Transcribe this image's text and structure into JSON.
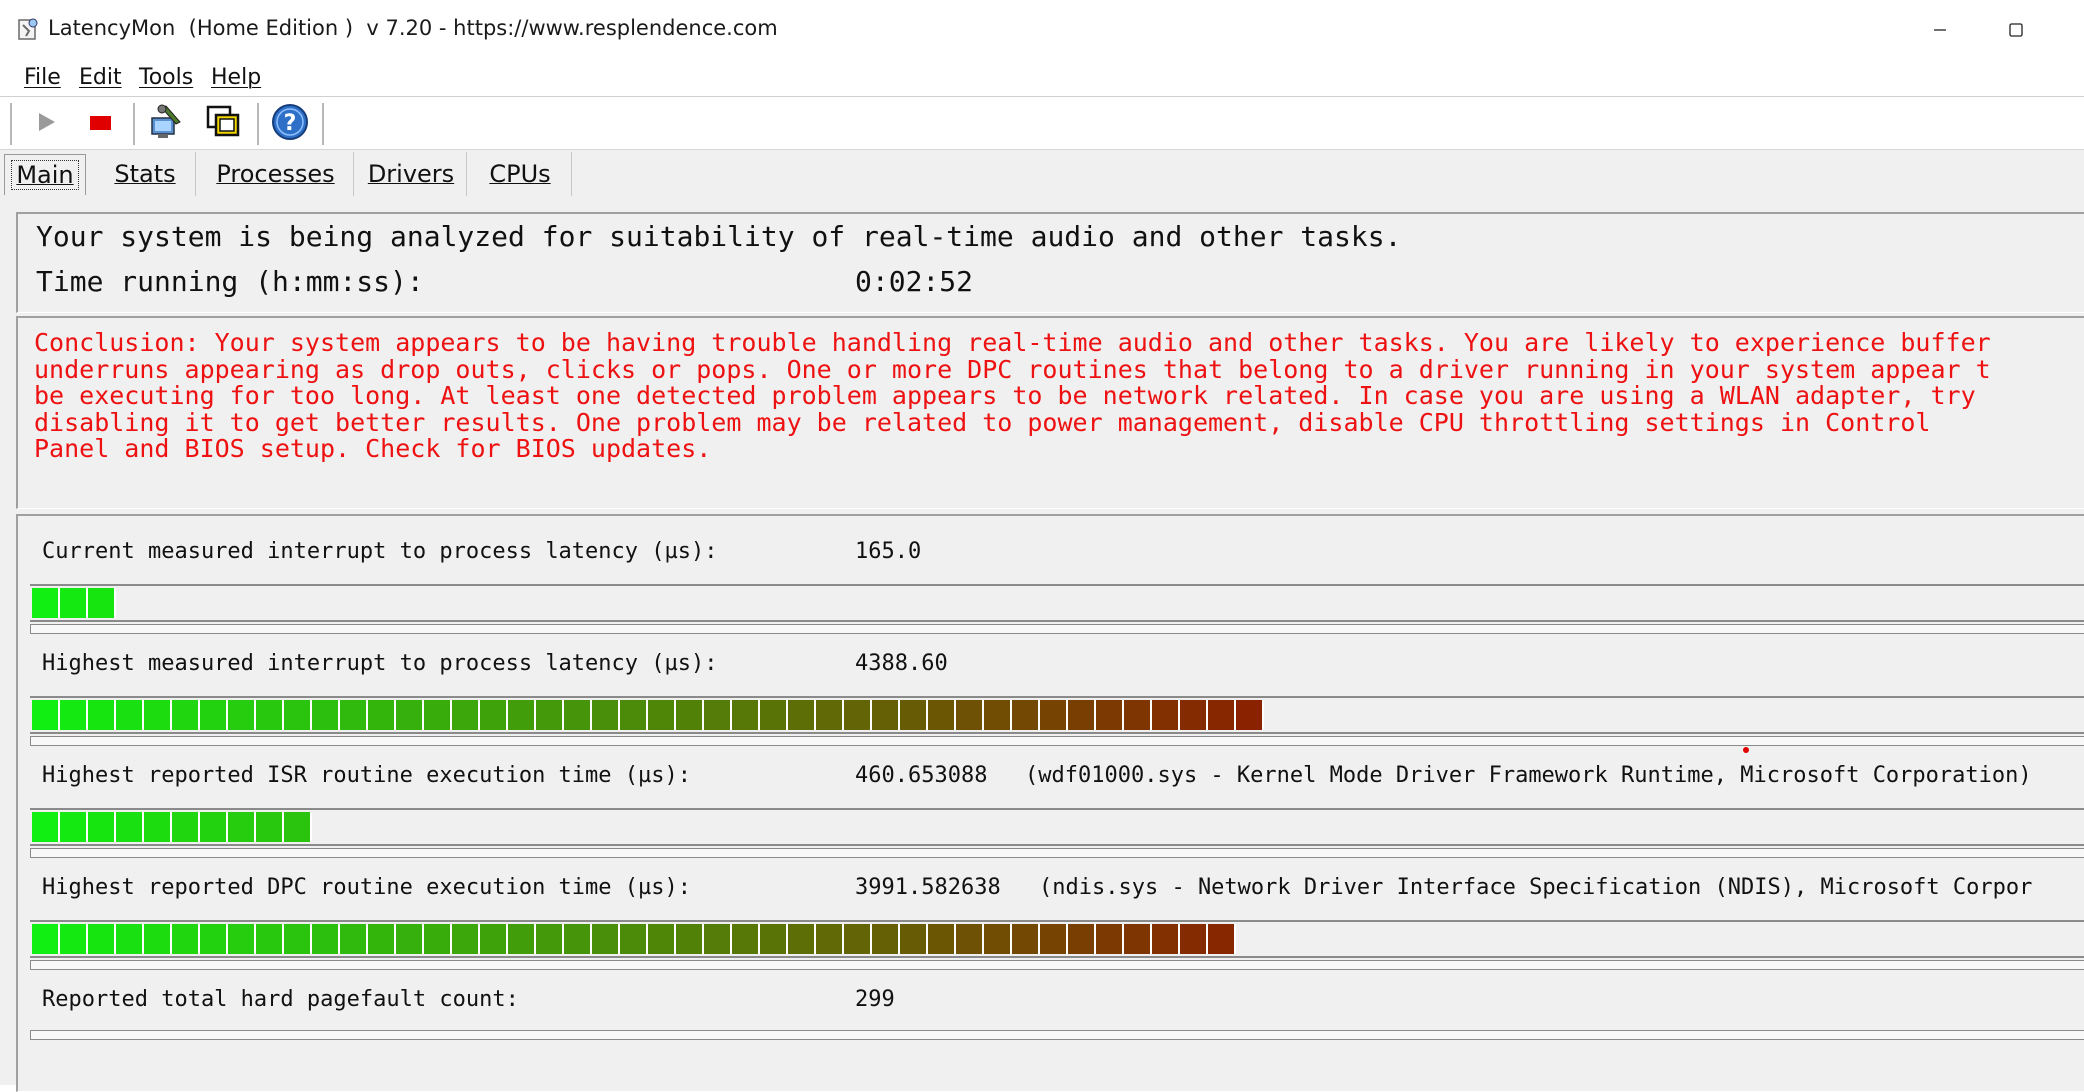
{
  "window": {
    "title": "LatencyMon  (Home Edition )  v 7.20 - https://www.resplendence.com",
    "app_icon": "latencymon-app-icon"
  },
  "menu": [
    {
      "label": "File",
      "icon": null
    },
    {
      "label": "Edit",
      "icon": null
    },
    {
      "label": "Tools",
      "icon": null
    },
    {
      "label": "Help",
      "icon": null
    }
  ],
  "toolbar": {
    "buttons": [
      {
        "name": "start",
        "icon": "play-icon"
      },
      {
        "name": "stop",
        "icon": "stop-icon"
      },
      {
        "name": "tools",
        "icon": "wrench-computer-icon"
      },
      {
        "name": "windows",
        "icon": "cascade-windows-icon"
      },
      {
        "name": "help",
        "icon": "help-icon"
      }
    ]
  },
  "tabs": [
    {
      "label": "Main",
      "active": true
    },
    {
      "label": "Stats",
      "active": false
    },
    {
      "label": "Processes",
      "active": false
    },
    {
      "label": "Drivers",
      "active": false
    },
    {
      "label": "CPUs",
      "active": false
    }
  ],
  "status": {
    "analysis_text": "Your system is being analyzed for suitability of real-time audio and other tasks.",
    "time_label": "Time running (h:mm:ss):",
    "time_value": "0:02:52"
  },
  "conclusion": "Conclusion: Your system appears to be having trouble handling real-time audio and other tasks. You are likely to experience buffer\nunderruns appearing as drop outs, clicks or pops. One or more DPC routines that belong to a driver running in your system appear t\nbe executing for too long. At least one detected problem appears to be network related. In case you are using a WLAN adapter, try\ndisabling it to get better results. One problem may be related to power management, disable CPU throttling settings in Control\nPanel and BIOS setup. Check for BIOS updates.",
  "metrics": [
    {
      "label": "Current measured interrupt to process latency (µs):",
      "value": "165.0",
      "detail": "",
      "bar_segments": 3
    },
    {
      "label": "Highest measured interrupt to process latency (µs):",
      "value": "4388.60",
      "detail": "",
      "bar_segments": 44
    },
    {
      "label": "Highest reported ISR routine execution time (µs):",
      "value": "460.653088",
      "detail": "(wdf01000.sys - Kernel Mode Driver Framework Runtime, Microsoft Corporation)",
      "bar_segments": 10
    },
    {
      "label": "Highest reported DPC routine execution time (µs):",
      "value": "3991.582638",
      "detail": "(ndis.sys - Network Driver Interface Specification (NDIS), Microsoft Corpor",
      "bar_segments": 43
    },
    {
      "label": "Reported total hard pagefault count:",
      "value": "299",
      "detail": "",
      "bar_segments": 0
    }
  ],
  "colors": {
    "conclusion_text": "#ee1111",
    "bar_start": "#11ee11",
    "bar_end": "#8a2200",
    "stop_red": "#e00000"
  }
}
